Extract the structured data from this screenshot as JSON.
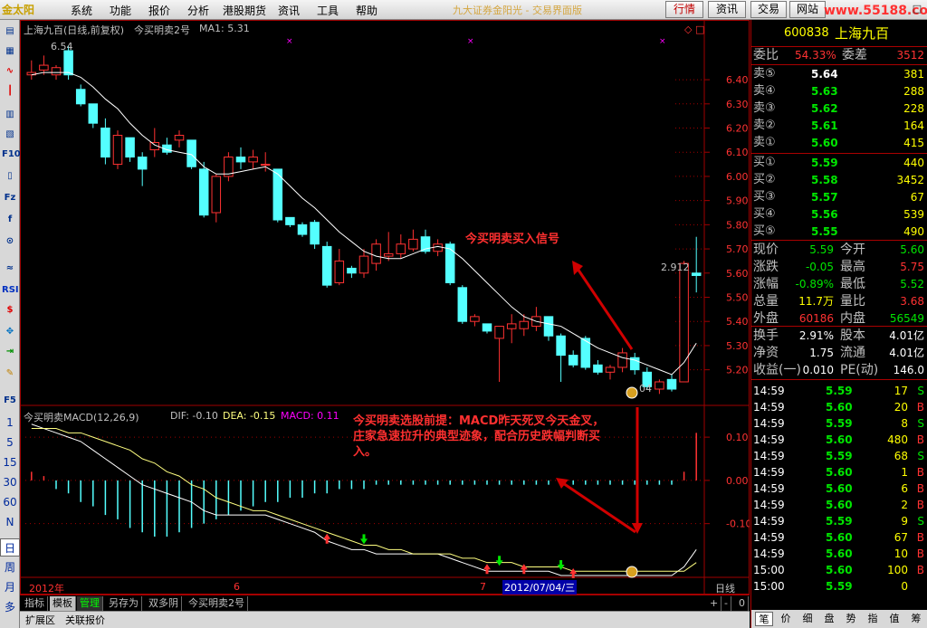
{
  "menubar": {
    "logo": "金太阳",
    "items": [
      "系统",
      "功能",
      "报价",
      "分析",
      "港股期货",
      "资讯",
      "工具",
      "帮助"
    ],
    "center_title": "九大证券金阳光 - 交易界面版",
    "buttons": [
      "行情",
      "资讯",
      "交易",
      "网站"
    ],
    "watermark": "www.55188.com",
    "window_controls": [
      "◇",
      "□"
    ]
  },
  "toolstrip": {
    "icons": [
      "page-icon",
      "grid-icon",
      "line-chart-icon",
      "kline-icon",
      "table-icon",
      "report-icon",
      "F10",
      "F10-doc",
      "F10-page",
      "Fiz",
      "magnify-f",
      "search-icon",
      "wave-icon",
      "RSI",
      "dollar-icon",
      "arrows-icon",
      "export-icon",
      "pencil-icon",
      "F5"
    ],
    "periods": [
      "1",
      "5",
      "15",
      "30",
      "60",
      "N",
      "日",
      "周",
      "月",
      "多"
    ]
  },
  "chart": {
    "header": {
      "stock": "上海九百(日线,前复权)",
      "formula": "今买明卖2号",
      "ma_label": "MA1: 5.31"
    },
    "high_label": "6.54",
    "last_label": "2.912",
    "low_label": "04",
    "annotation1": "今买明卖买入信号",
    "annotation2": "今买明卖选股前提：MACD昨天死叉今天金叉，庄家急速拉升的典型迹象，配合历史跌幅判断买入。",
    "macd_header": {
      "name": "今买明卖MACD(12,26,9)",
      "dif": "DIF: -0.10",
      "dea": "DEA: -0.15",
      "macd": "MACD: 0.11"
    },
    "price_axis": [
      "6.40",
      "6.30",
      "6.20",
      "6.10",
      "6.00",
      "5.90",
      "5.80",
      "5.70",
      "5.60",
      "5.50",
      "5.40",
      "5.30",
      "5.20"
    ],
    "macd_axis": [
      "0.10",
      "0.00",
      "-0.10"
    ],
    "date_axis": {
      "year": "2012年",
      "m6": "6",
      "m7": "7",
      "cursor": "2012/07/04/三",
      "period": "日线"
    },
    "colors": {
      "up": "#ff3232",
      "down": "#54ffff",
      "ma": "#ffffff",
      "dif": "#ffffff",
      "dea": "#ffff80",
      "grid": "#a00000",
      "signal_up": "#ff3232",
      "signal_down": "#00e600",
      "arrow": "#d00000"
    }
  },
  "chart_data": {
    "type": "candlestick",
    "title": "上海九百(日线,前复权)",
    "y_range": [
      5.12,
      6.58
    ],
    "candles": [
      {
        "o": 6.42,
        "h": 6.48,
        "l": 6.4,
        "c": 6.43
      },
      {
        "o": 6.44,
        "h": 6.5,
        "l": 6.42,
        "c": 6.46
      },
      {
        "o": 6.42,
        "h": 6.46,
        "l": 6.4,
        "c": 6.45
      },
      {
        "o": 6.52,
        "h": 6.54,
        "l": 6.4,
        "c": 6.42
      },
      {
        "o": 6.36,
        "h": 6.38,
        "l": 6.29,
        "c": 6.3
      },
      {
        "o": 6.3,
        "h": 6.3,
        "l": 6.2,
        "c": 6.22
      },
      {
        "o": 6.2,
        "h": 6.24,
        "l": 6.05,
        "c": 6.08
      },
      {
        "o": 6.05,
        "h": 6.19,
        "l": 6.03,
        "c": 6.17
      },
      {
        "o": 6.16,
        "h": 6.16,
        "l": 6.06,
        "c": 6.08
      },
      {
        "o": 6.08,
        "h": 6.1,
        "l": 5.96,
        "c": 6.03
      },
      {
        "o": 6.11,
        "h": 6.2,
        "l": 6.08,
        "c": 6.14
      },
      {
        "o": 6.13,
        "h": 6.16,
        "l": 6.09,
        "c": 6.1
      },
      {
        "o": 6.15,
        "h": 6.19,
        "l": 6.12,
        "c": 6.17
      },
      {
        "o": 6.15,
        "h": 6.15,
        "l": 6.03,
        "c": 6.04
      },
      {
        "o": 6.03,
        "h": 6.06,
        "l": 5.83,
        "c": 5.84
      },
      {
        "o": 5.85,
        "h": 6.01,
        "l": 5.81,
        "c": 6.0
      },
      {
        "o": 6.0,
        "h": 6.1,
        "l": 5.98,
        "c": 6.08
      },
      {
        "o": 6.08,
        "h": 6.12,
        "l": 6.03,
        "c": 6.06
      },
      {
        "o": 6.06,
        "h": 6.11,
        "l": 6.03,
        "c": 6.08
      },
      {
        "o": 6.05,
        "h": 6.1,
        "l": 6.02,
        "c": 6.05
      },
      {
        "o": 6.03,
        "h": 6.03,
        "l": 5.81,
        "c": 5.82
      },
      {
        "o": 5.83,
        "h": 5.83,
        "l": 5.79,
        "c": 5.8
      },
      {
        "o": 5.8,
        "h": 5.81,
        "l": 5.75,
        "c": 5.76
      },
      {
        "o": 5.81,
        "h": 5.82,
        "l": 5.7,
        "c": 5.72
      },
      {
        "o": 5.71,
        "h": 5.73,
        "l": 5.54,
        "c": 5.55
      },
      {
        "o": 5.56,
        "h": 5.7,
        "l": 5.55,
        "c": 5.65
      },
      {
        "o": 5.62,
        "h": 5.63,
        "l": 5.58,
        "c": 5.6
      },
      {
        "o": 5.6,
        "h": 5.7,
        "l": 5.58,
        "c": 5.67
      },
      {
        "o": 5.64,
        "h": 5.74,
        "l": 5.61,
        "c": 5.72
      },
      {
        "o": 5.67,
        "h": 5.77,
        "l": 5.65,
        "c": 5.68
      },
      {
        "o": 5.68,
        "h": 5.76,
        "l": 5.66,
        "c": 5.72
      },
      {
        "o": 5.7,
        "h": 5.78,
        "l": 5.69,
        "c": 5.74
      },
      {
        "o": 5.75,
        "h": 5.78,
        "l": 5.68,
        "c": 5.69
      },
      {
        "o": 5.69,
        "h": 5.74,
        "l": 5.67,
        "c": 5.72
      },
      {
        "o": 5.72,
        "h": 5.73,
        "l": 5.55,
        "c": 5.56
      },
      {
        "o": 5.54,
        "h": 5.55,
        "l": 5.39,
        "c": 5.4
      },
      {
        "o": 5.4,
        "h": 5.43,
        "l": 5.38,
        "c": 5.42
      },
      {
        "o": 5.39,
        "h": 5.39,
        "l": 5.35,
        "c": 5.36
      },
      {
        "o": 5.33,
        "h": 5.38,
        "l": 5.15,
        "c": 5.38
      },
      {
        "o": 5.37,
        "h": 5.43,
        "l": 5.31,
        "c": 5.39
      },
      {
        "o": 5.37,
        "h": 5.43,
        "l": 5.34,
        "c": 5.4
      },
      {
        "o": 5.38,
        "h": 5.46,
        "l": 5.36,
        "c": 5.42
      },
      {
        "o": 5.42,
        "h": 5.42,
        "l": 5.32,
        "c": 5.34
      },
      {
        "o": 5.34,
        "h": 5.35,
        "l": 5.15,
        "c": 5.26
      },
      {
        "o": 5.26,
        "h": 5.28,
        "l": 5.21,
        "c": 5.22
      },
      {
        "o": 5.33,
        "h": 5.34,
        "l": 5.2,
        "c": 5.21
      },
      {
        "o": 5.22,
        "h": 5.24,
        "l": 5.18,
        "c": 5.19
      },
      {
        "o": 5.19,
        "h": 5.22,
        "l": 5.16,
        "c": 5.21
      },
      {
        "o": 5.21,
        "h": 5.29,
        "l": 5.19,
        "c": 5.27
      },
      {
        "o": 5.25,
        "h": 5.27,
        "l": 5.18,
        "c": 5.2
      },
      {
        "o": 5.19,
        "h": 5.21,
        "l": 5.12,
        "c": 5.13
      },
      {
        "o": 5.12,
        "h": 5.16,
        "l": 5.1,
        "c": 5.15
      },
      {
        "o": 5.16,
        "h": 5.18,
        "l": 5.11,
        "c": 5.12
      },
      {
        "o": 5.15,
        "h": 5.65,
        "l": 5.15,
        "c": 5.64
      },
      {
        "o": 5.6,
        "h": 5.75,
        "l": 5.52,
        "c": 5.59
      }
    ],
    "ma": [
      6.42,
      6.43,
      6.43,
      6.43,
      6.41,
      6.37,
      6.32,
      6.28,
      6.22,
      6.17,
      6.13,
      6.11,
      6.1,
      6.09,
      6.04,
      6.01,
      6.01,
      6.02,
      6.03,
      6.04,
      6.01,
      5.96,
      5.91,
      5.87,
      5.82,
      5.77,
      5.73,
      5.69,
      5.67,
      5.66,
      5.66,
      5.68,
      5.7,
      5.71,
      5.7,
      5.66,
      5.61,
      5.56,
      5.51,
      5.46,
      5.42,
      5.4,
      5.39,
      5.38,
      5.35,
      5.32,
      5.29,
      5.27,
      5.25,
      5.24,
      5.22,
      5.2,
      5.18,
      5.23,
      5.31
    ],
    "macd": {
      "dif": [
        0.13,
        0.12,
        0.11,
        0.1,
        0.09,
        0.07,
        0.05,
        0.03,
        0.01,
        -0.01,
        -0.02,
        -0.03,
        -0.04,
        -0.05,
        -0.07,
        -0.08,
        -0.08,
        -0.08,
        -0.08,
        -0.08,
        -0.09,
        -0.1,
        -0.11,
        -0.12,
        -0.14,
        -0.15,
        -0.16,
        -0.16,
        -0.17,
        -0.17,
        -0.17,
        -0.17,
        -0.17,
        -0.17,
        -0.18,
        -0.19,
        -0.2,
        -0.21,
        -0.21,
        -0.21,
        -0.21,
        -0.21,
        -0.21,
        -0.22,
        -0.22,
        -0.22,
        -0.22,
        -0.22,
        -0.22,
        -0.22,
        -0.22,
        -0.22,
        -0.22,
        -0.2,
        -0.16
      ],
      "dea": [
        0.12,
        0.12,
        0.12,
        0.11,
        0.11,
        0.1,
        0.09,
        0.08,
        0.07,
        0.05,
        0.04,
        0.02,
        0.01,
        -0.01,
        -0.02,
        -0.04,
        -0.05,
        -0.06,
        -0.07,
        -0.07,
        -0.08,
        -0.09,
        -0.1,
        -0.11,
        -0.12,
        -0.13,
        -0.14,
        -0.15,
        -0.15,
        -0.16,
        -0.16,
        -0.17,
        -0.17,
        -0.17,
        -0.17,
        -0.18,
        -0.18,
        -0.19,
        -0.19,
        -0.19,
        -0.2,
        -0.2,
        -0.2,
        -0.2,
        -0.21,
        -0.21,
        -0.21,
        -0.21,
        -0.21,
        -0.21,
        -0.21,
        -0.21,
        -0.21,
        -0.21,
        -0.19
      ],
      "bars": [
        0.02,
        0.01,
        -0.02,
        -0.03,
        -0.05,
        -0.06,
        -0.08,
        -0.09,
        -0.11,
        -0.12,
        -0.13,
        -0.13,
        -0.12,
        -0.11,
        -0.1,
        -0.09,
        -0.08,
        -0.07,
        -0.06,
        -0.05,
        -0.05,
        -0.04,
        -0.04,
        -0.03,
        -0.03,
        -0.02,
        -0.02,
        -0.02,
        -0.01,
        -0.01,
        -0.01,
        -0.01,
        -0.01,
        -0.01,
        -0.01,
        -0.01,
        -0.01,
        -0.01,
        -0.01,
        -0.01,
        -0.01,
        -0.01,
        -0.01,
        -0.01,
        -0.01,
        -0.01,
        -0.01,
        -0.01,
        -0.01,
        -0.01,
        -0.01,
        -0.01,
        -0.01,
        0.02,
        0.11
      ],
      "signals": [
        {
          "i": 24,
          "type": "up"
        },
        {
          "i": 27,
          "type": "down"
        },
        {
          "i": 37,
          "type": "up"
        },
        {
          "i": 38,
          "type": "down"
        },
        {
          "i": 40,
          "type": "up"
        },
        {
          "i": 43,
          "type": "down"
        },
        {
          "i": 44,
          "type": "up"
        }
      ],
      "y_range": [
        -0.22,
        0.14
      ]
    }
  },
  "bottom_tabs": [
    "指标",
    "模板",
    "管理",
    "另存为",
    "双多阴",
    "今买明卖2号"
  ],
  "bottom_ctrl": [
    "+",
    "-",
    "0"
  ],
  "statusbar": [
    "扩展区",
    "关联报价"
  ],
  "quote": {
    "code": "600838",
    "name": "上海九百",
    "wei_bi_label": "委比",
    "wei_bi": "54.33%",
    "wei_cha_label": "委差",
    "wei_cha": "3512",
    "asks": [
      {
        "label": "卖⑤",
        "price": "5.64",
        "vol": "381"
      },
      {
        "label": "卖④",
        "price": "5.63",
        "vol": "288"
      },
      {
        "label": "卖③",
        "price": "5.62",
        "vol": "228"
      },
      {
        "label": "卖②",
        "price": "5.61",
        "vol": "164"
      },
      {
        "label": "卖①",
        "price": "5.60",
        "vol": "415"
      }
    ],
    "bids": [
      {
        "label": "买①",
        "price": "5.59",
        "vol": "440"
      },
      {
        "label": "买②",
        "price": "5.58",
        "vol": "3452"
      },
      {
        "label": "买③",
        "price": "5.57",
        "vol": "67"
      },
      {
        "label": "买④",
        "price": "5.56",
        "vol": "539"
      },
      {
        "label": "买⑤",
        "price": "5.55",
        "vol": "490"
      }
    ],
    "stats": [
      {
        "l1": "现价",
        "v1": "5.59",
        "c1": "green",
        "l2": "今开",
        "v2": "5.60",
        "c2": "green"
      },
      {
        "l1": "涨跌",
        "v1": "-0.05",
        "c1": "green",
        "l2": "最高",
        "v2": "5.75",
        "c2": "red"
      },
      {
        "l1": "涨幅",
        "v1": "-0.89%",
        "c1": "green",
        "l2": "最低",
        "v2": "5.52",
        "c2": "green"
      },
      {
        "l1": "总量",
        "v1": "11.7万",
        "c1": "yellow",
        "l2": "量比",
        "v2": "3.68",
        "c2": "red"
      },
      {
        "l1": "外盘",
        "v1": "60186",
        "c1": "red",
        "l2": "内盘",
        "v2": "56549",
        "c2": "green"
      }
    ],
    "stats2": [
      {
        "l1": "换手",
        "v1": "2.91%",
        "l2": "股本",
        "v2": "4.01亿"
      },
      {
        "l1": "净资",
        "v1": "1.75",
        "l2": "流通",
        "v2": "4.01亿"
      },
      {
        "l1": "收益(一)",
        "v1": "0.010",
        "l2": "PE(动)",
        "v2": "146.0"
      }
    ],
    "ticks": [
      {
        "t": "14:59",
        "p": "5.59",
        "pc": "green",
        "v": "17",
        "s": "S",
        "sc": "green"
      },
      {
        "t": "14:59",
        "p": "5.60",
        "pc": "green",
        "v": "20",
        "s": "B",
        "sc": "red"
      },
      {
        "t": "14:59",
        "p": "5.59",
        "pc": "green",
        "v": "8",
        "s": "S",
        "sc": "green"
      },
      {
        "t": "14:59",
        "p": "5.60",
        "pc": "green",
        "v": "480",
        "s": "B",
        "sc": "red"
      },
      {
        "t": "14:59",
        "p": "5.59",
        "pc": "green",
        "v": "68",
        "s": "S",
        "sc": "green"
      },
      {
        "t": "14:59",
        "p": "5.60",
        "pc": "green",
        "v": "1",
        "s": "B",
        "sc": "red"
      },
      {
        "t": "14:59",
        "p": "5.60",
        "pc": "green",
        "v": "6",
        "s": "B",
        "sc": "red"
      },
      {
        "t": "14:59",
        "p": "5.60",
        "pc": "green",
        "v": "2",
        "s": "B",
        "sc": "red"
      },
      {
        "t": "14:59",
        "p": "5.59",
        "pc": "green",
        "v": "9",
        "s": "S",
        "sc": "green"
      },
      {
        "t": "14:59",
        "p": "5.60",
        "pc": "green",
        "v": "67",
        "s": "B",
        "sc": "red"
      },
      {
        "t": "14:59",
        "p": "5.60",
        "pc": "green",
        "v": "10",
        "s": "B",
        "sc": "red"
      },
      {
        "t": "15:00",
        "p": "5.60",
        "pc": "green",
        "v": "100",
        "s": "B",
        "sc": "red"
      },
      {
        "t": "15:00",
        "p": "5.59",
        "pc": "green",
        "v": "0",
        "s": "",
        "sc": "white"
      }
    ],
    "tabs": [
      "笔",
      "价",
      "细",
      "盘",
      "势",
      "指",
      "值",
      "筹"
    ]
  }
}
